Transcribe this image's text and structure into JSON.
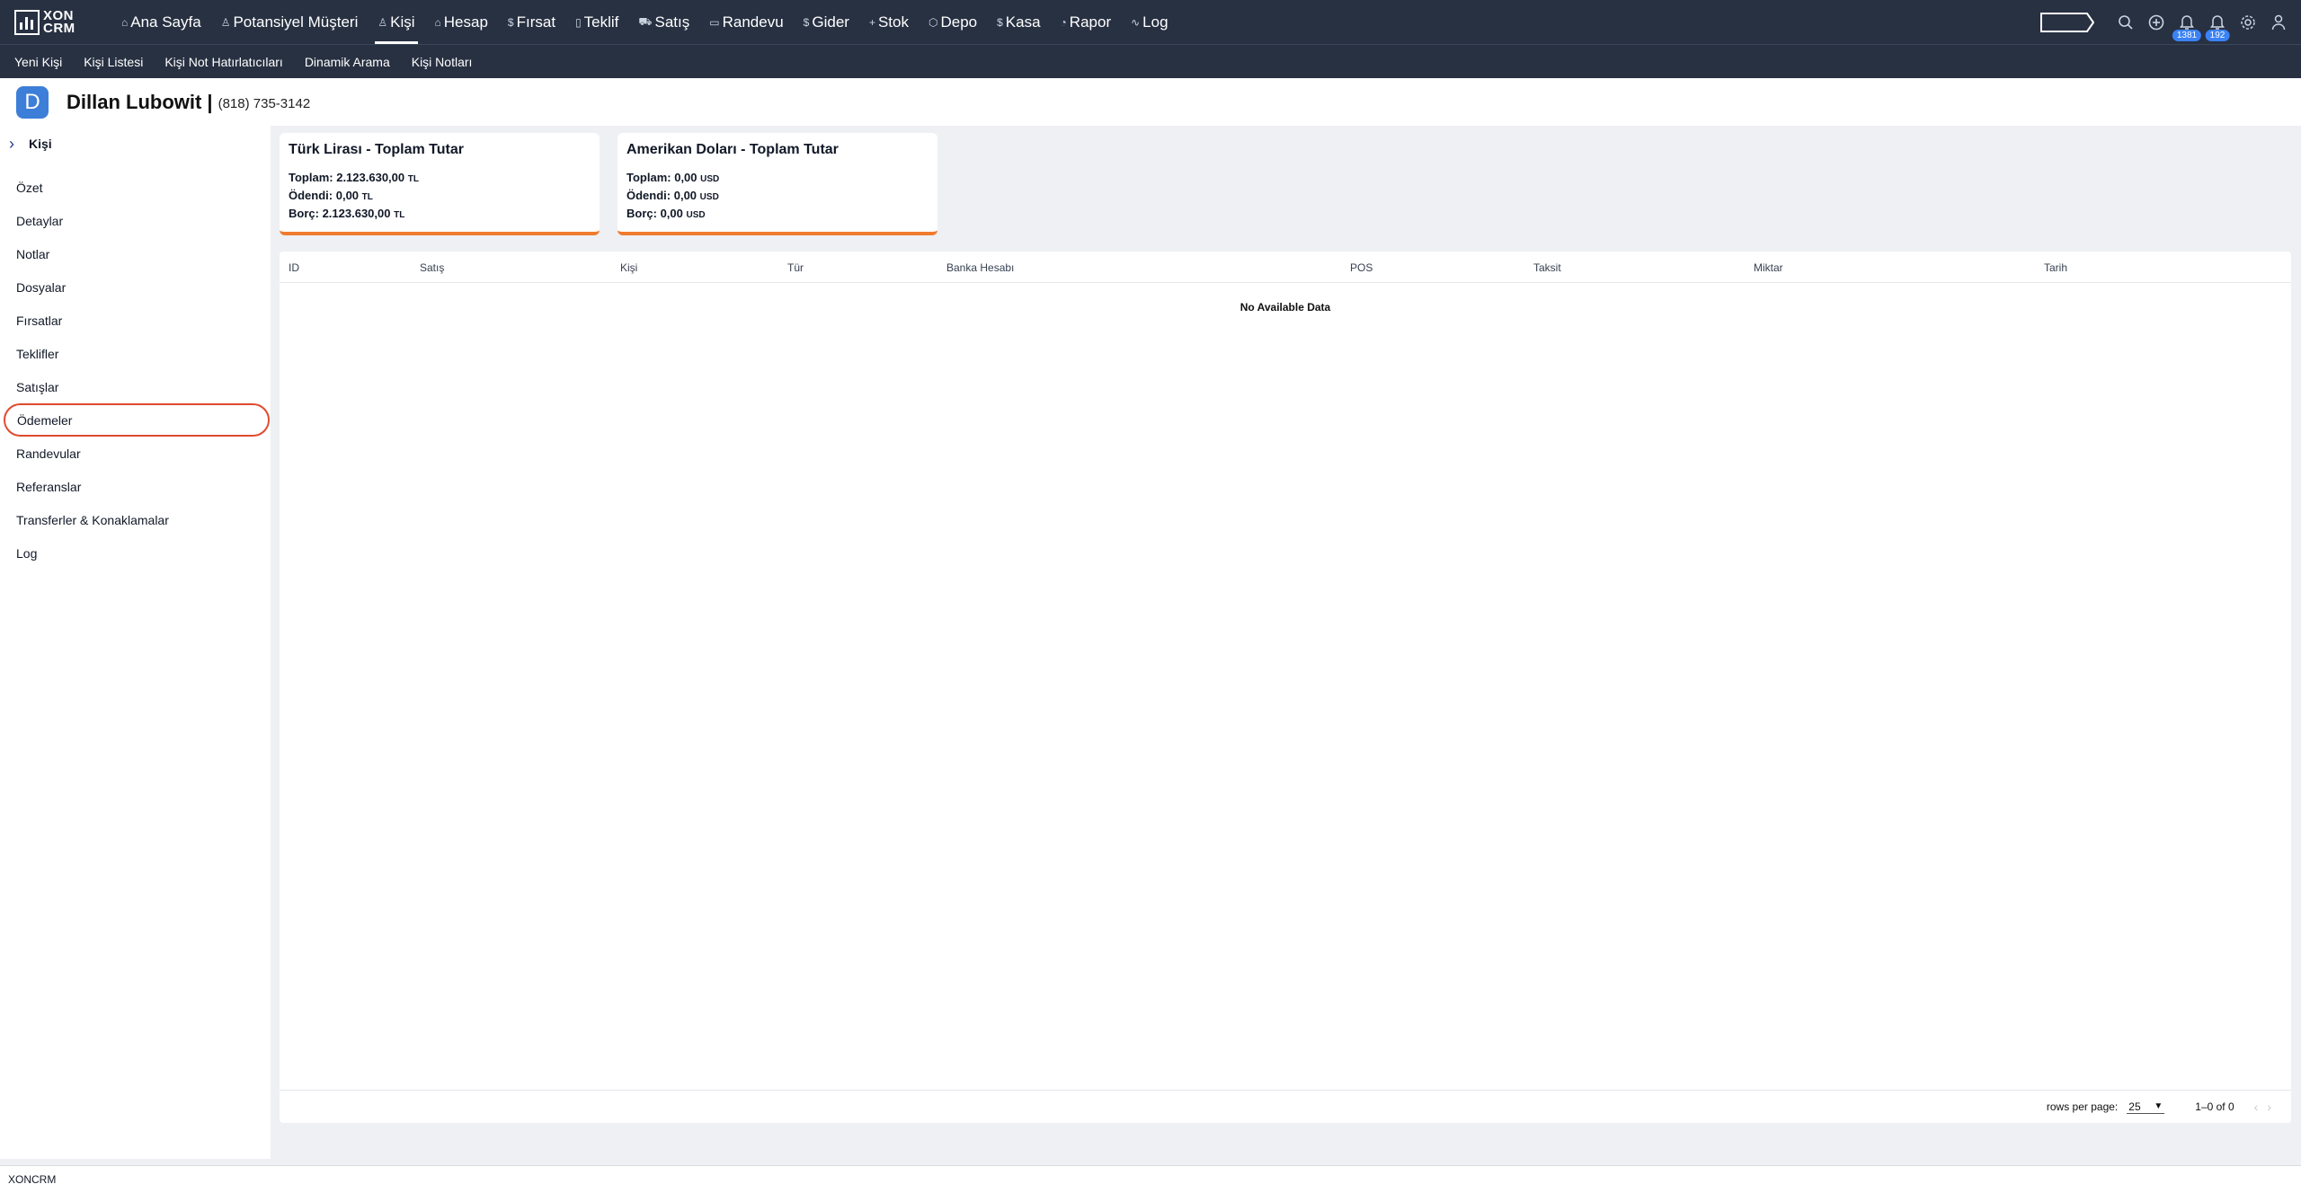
{
  "brand": {
    "line1": "XON",
    "line2": "CRM"
  },
  "nav": {
    "items": [
      {
        "label": "Ana Sayfa",
        "icon": "home-icon",
        "glyph": "⌂",
        "active": false
      },
      {
        "label": "Potansiyel Müşteri",
        "icon": "user-icon",
        "glyph": "♙",
        "active": false
      },
      {
        "label": "Kişi",
        "icon": "users-icon",
        "glyph": "♙",
        "active": true
      },
      {
        "label": "Hesap",
        "icon": "bank-icon",
        "glyph": "⌂",
        "active": false
      },
      {
        "label": "Fırsat",
        "icon": "dollar-icon",
        "glyph": "$",
        "active": false
      },
      {
        "label": "Teklif",
        "icon": "document-icon",
        "glyph": "▯",
        "active": false
      },
      {
        "label": "Satış",
        "icon": "cart-icon",
        "glyph": "⛟",
        "active": false
      },
      {
        "label": "Randevu",
        "icon": "calendar-icon",
        "glyph": "▭",
        "active": false
      },
      {
        "label": "Gider",
        "icon": "dollar-icon",
        "glyph": "$",
        "active": false
      },
      {
        "label": "Stok",
        "icon": "plus-icon",
        "glyph": "+",
        "active": false
      },
      {
        "label": "Depo",
        "icon": "box-icon",
        "glyph": "⬡",
        "active": false
      },
      {
        "label": "Kasa",
        "icon": "dollar-icon",
        "glyph": "$",
        "active": false
      },
      {
        "label": "Rapor",
        "icon": "chart-icon",
        "glyph": "◔",
        "active": false
      },
      {
        "label": "Log",
        "icon": "activity-icon",
        "glyph": "∿",
        "active": false
      }
    ],
    "notifications_count_1": "1381",
    "notifications_count_2": "192"
  },
  "subnav": {
    "items": [
      "Yeni Kişi",
      "Kişi Listesi",
      "Kişi Not Hatırlatıcıları",
      "Dinamik Arama",
      "Kişi Notları"
    ]
  },
  "person": {
    "initial": "D",
    "name": "Dillan Lubowit |",
    "phone": "(818) 735-3142"
  },
  "sidebar": {
    "header": "Kişi",
    "items": [
      {
        "label": "Özet",
        "active": false
      },
      {
        "label": "Detaylar",
        "active": false
      },
      {
        "label": "Notlar",
        "active": false
      },
      {
        "label": "Dosyalar",
        "active": false
      },
      {
        "label": "Fırsatlar",
        "active": false
      },
      {
        "label": "Teklifler",
        "active": false
      },
      {
        "label": "Satışlar",
        "active": false
      },
      {
        "label": "Ödemeler",
        "active": true
      },
      {
        "label": "Randevular",
        "active": false
      },
      {
        "label": "Referanslar",
        "active": false
      },
      {
        "label": "Transferler & Konaklamalar",
        "active": false
      },
      {
        "label": "Log",
        "active": false
      }
    ]
  },
  "cards": [
    {
      "title": "Türk Lirası - Toplam Tutar",
      "total_label": "Toplam:",
      "total": "2.123.630,00",
      "currency": "TL",
      "paid_label": "Ödendi:",
      "paid": "0,00",
      "debt_label": "Borç:",
      "debt": "2.123.630,00"
    },
    {
      "title": "Amerikan Doları - Toplam Tutar",
      "total_label": "Toplam:",
      "total": "0,00",
      "currency": "USD",
      "paid_label": "Ödendi:",
      "paid": "0,00",
      "debt_label": "Borç:",
      "debt": "0,00"
    }
  ],
  "table": {
    "columns": [
      "ID",
      "Satış",
      "Kişi",
      "Tür",
      "Banka Hesabı",
      "POS",
      "Taksit",
      "Miktar",
      "Tarih"
    ],
    "empty_text": "No Available Data",
    "rows_per_page_label": "rows per page:",
    "rows_per_page": "25",
    "range": "1–0 of 0"
  },
  "footer": {
    "text": "XONCRM"
  },
  "colors": {
    "topbar": "#283142",
    "accent_orange": "#f07b2f",
    "active_ring": "#e04a2f",
    "avatar": "#3d7ed8",
    "badge": "#3b82f6"
  }
}
